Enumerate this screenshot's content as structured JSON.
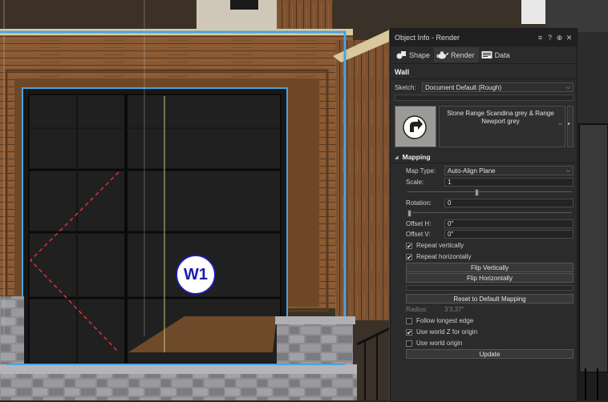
{
  "panel": {
    "title": "Object Info - Render",
    "controls": {
      "menu": "≡",
      "help": "?",
      "pin": "⊕",
      "close": "✕"
    },
    "tabs": [
      {
        "label": "Shape",
        "icon": "shape-icon"
      },
      {
        "label": "Render",
        "icon": "teapot-icon"
      },
      {
        "label": "Data",
        "icon": "data-icon"
      }
    ],
    "object_type": "Wall",
    "sketch_label": "Sketch:",
    "sketch_value": "Document Default (Rough)",
    "texture_name": "Stone Range Scandina grey & Range Newport grey",
    "mapping_header": "Mapping",
    "map_type_label": "Map Type:",
    "map_type_value": "Auto-Align Plane",
    "scale_label": "Scale:",
    "scale_value": "1",
    "scale_level": 0.42,
    "rotation_label": "Rotation:",
    "rotation_value": "0",
    "rotation_level": 0.0,
    "offset_h_label": "Offset H:",
    "offset_h_value": "0\"",
    "offset_v_label": "Offset V:",
    "offset_v_value": "0\"",
    "repeat_vertically": {
      "label": "Repeat vertically",
      "checked": true
    },
    "repeat_horizontally": {
      "label": "Repeat horizontally",
      "checked": true
    },
    "flip_vertically": "Flip Vertically",
    "flip_horizontally": "Flip Horizontally",
    "reset_mapping": "Reset to Default Mapping",
    "radius_label": "Radius:",
    "radius_value": "3'3.37\"",
    "follow_longest_edge": {
      "label": "Follow longest edge",
      "checked": false
    },
    "use_world_z": {
      "label": "Use world Z for origin",
      "checked": true
    },
    "use_world_origin": {
      "label": "Use world origin",
      "checked": false
    },
    "update": "Update"
  },
  "scene": {
    "window_tag": "W1"
  },
  "colors": {
    "panel_bg": "#2b2b2b",
    "highlight_blue": "#4aa3e0",
    "tag_text": "#1b1bb0"
  }
}
